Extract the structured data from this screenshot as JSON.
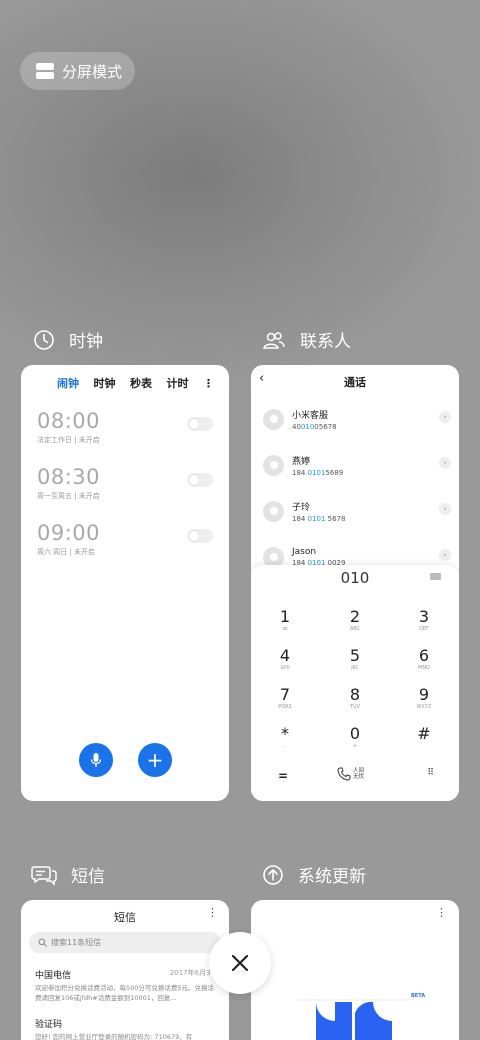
{
  "split_mode": {
    "label": "分屏模式"
  },
  "cards": {
    "clock": {
      "app_name": "时钟",
      "tabs": [
        "闹钟",
        "时钟",
        "秒表",
        "计时"
      ],
      "alarms": [
        {
          "time": "08:00",
          "desc": "法定工作日 | 未开启"
        },
        {
          "time": "08:30",
          "desc": "周一至周五 | 未开启"
        },
        {
          "time": "09:00",
          "desc": "周六 周日 | 未开启"
        }
      ]
    },
    "contacts": {
      "app_name": "联系人",
      "title": "通话",
      "list": [
        {
          "name": "小米客服",
          "num_pre": "40",
          "num_hl": "010",
          "num_post": "05678"
        },
        {
          "name": "燕婷",
          "num_pre": "184 ",
          "num_hl": "0101",
          "num_post": "5689"
        },
        {
          "name": "子玲",
          "num_pre": "184 ",
          "num_hl": "0101",
          "num_post": " 5678"
        },
        {
          "name": "Jason",
          "num_pre": "184 ",
          "num_hl": "0101",
          "num_post": " 0029"
        }
      ],
      "dialed": "010",
      "keys": [
        {
          "d": "1",
          "l": "ꝏ"
        },
        {
          "d": "2",
          "l": "ABC"
        },
        {
          "d": "3",
          "l": "DEF"
        },
        {
          "d": "4",
          "l": "GHI"
        },
        {
          "d": "5",
          "l": "JKL"
        },
        {
          "d": "6",
          "l": "MNO"
        },
        {
          "d": "7",
          "l": "PQRS"
        },
        {
          "d": "8",
          "l": "TUV"
        },
        {
          "d": "9",
          "l": "WXYZ"
        },
        {
          "d": "*",
          "l": ","
        },
        {
          "d": "0",
          "l": "+"
        },
        {
          "d": "#",
          "l": ""
        }
      ],
      "bottom_center": "人间\n无忧"
    },
    "messages": {
      "app_name": "短信",
      "title": "短信",
      "search_placeholder": "搜索11条短信",
      "items": [
        {
          "sender": "中国电信",
          "date": "2017年6月30",
          "body": "欢迎参加积分兑换话费活动，每500分可兑换话费5元。兑换话费请回复106或jfdh#话费金额到10001，回复..."
        },
        {
          "sender": "验证码",
          "date": "",
          "body": "您好! 您的网上营业厅登录的随机密码为: 710679，有"
        }
      ]
    },
    "update": {
      "app_name": "系统更新",
      "badge": "BETA"
    }
  },
  "colors": {
    "accent": "#1a73e8",
    "highlight": "#1a9de0"
  }
}
